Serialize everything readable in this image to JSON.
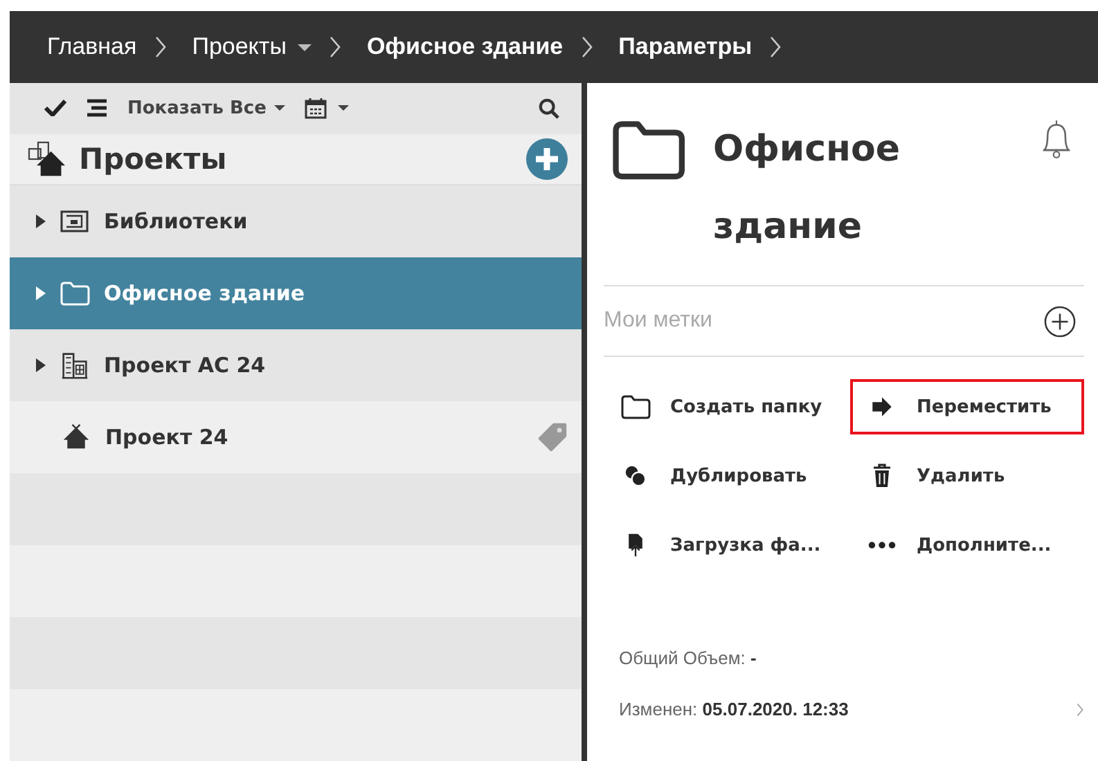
{
  "breadcrumbs": [
    {
      "label": "Главная",
      "emphasized": false,
      "dropdown": false
    },
    {
      "label": "Проекты",
      "emphasized": false,
      "dropdown": true
    },
    {
      "label": "Офисное здание",
      "emphasized": true,
      "dropdown": false
    },
    {
      "label": "Параметры",
      "emphasized": true,
      "dropdown": false
    }
  ],
  "toolbar": {
    "filter_label": "Показать Все"
  },
  "sidebar": {
    "title": "Проекты",
    "items": [
      {
        "label": "Библиотеки",
        "kind": "library",
        "expandable": true,
        "selected": false,
        "tagged": false
      },
      {
        "label": "Офисное здание",
        "kind": "folder",
        "expandable": true,
        "selected": true,
        "tagged": false
      },
      {
        "label": "Проект AC 24",
        "kind": "building",
        "expandable": true,
        "selected": false,
        "tagged": false
      },
      {
        "label": "Проект 24",
        "kind": "house",
        "expandable": false,
        "selected": false,
        "tagged": true
      }
    ]
  },
  "details": {
    "title": "Офисное здание",
    "tags_placeholder": "Мои метки",
    "actions": [
      {
        "label": "Создать папку",
        "kind": "folder",
        "highlighted": false
      },
      {
        "label": "Переместить",
        "kind": "arrow",
        "highlighted": true
      },
      {
        "label": "Дублировать",
        "kind": "circles",
        "highlighted": false
      },
      {
        "label": "Удалить",
        "kind": "trash",
        "highlighted": false
      },
      {
        "label": "Загрузка фа...",
        "kind": "upload",
        "highlighted": false
      },
      {
        "label": "Дополните...",
        "kind": "dots",
        "highlighted": false
      }
    ],
    "info": [
      "Общий Объем: **-**",
      "Изменен: **05.07.2020. 12:33**"
    ]
  }
}
